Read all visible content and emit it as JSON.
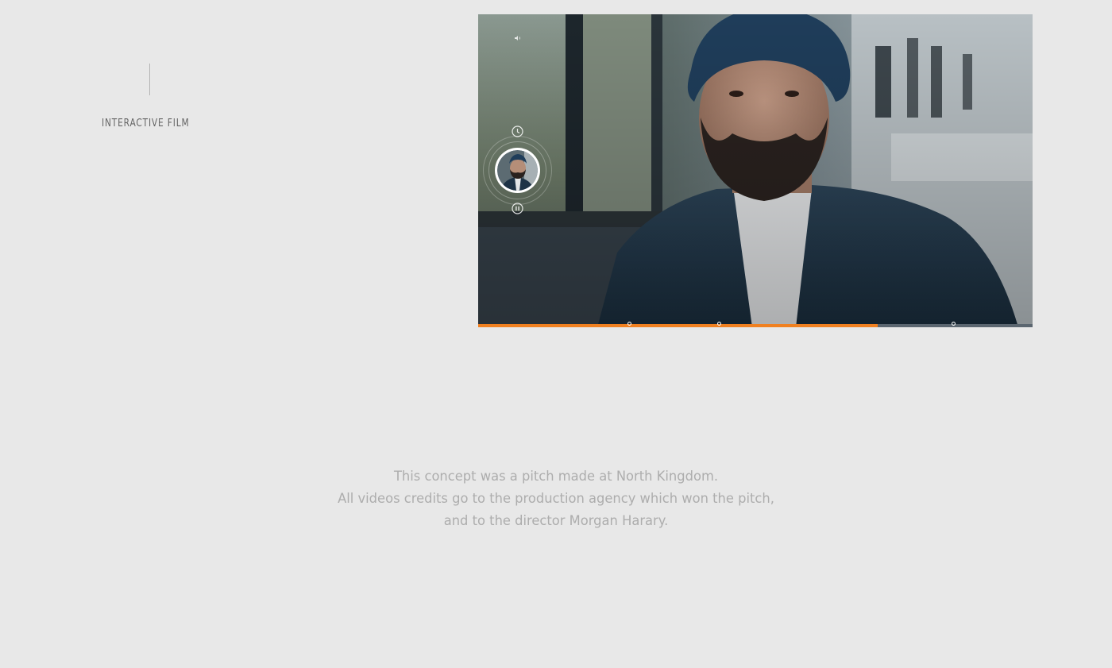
{
  "sidebar": {
    "label": "INTERACTIVE FILM"
  },
  "player": {
    "volume_icon": "volume-icon",
    "clock_icon": "clock-icon",
    "pause_icon": "pause-icon",
    "thumbnail": "chapter-thumbnail",
    "progress": 0.72,
    "chapter_markers": [
      0.272,
      0.434,
      0.857
    ],
    "accent_color": "#f08020"
  },
  "credits": {
    "line1": "This concept was a pitch made at North Kingdom.",
    "line2": "All videos credits go to the production agency which won the pitch,",
    "line3": "and to the director Morgan Harary."
  }
}
